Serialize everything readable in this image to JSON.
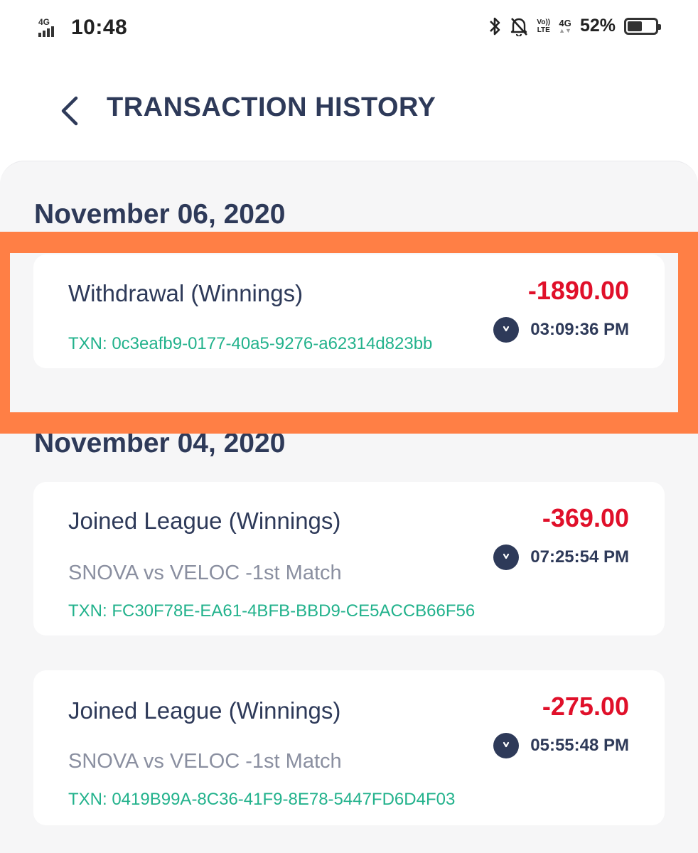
{
  "status_bar": {
    "network_label": "4G",
    "time": "10:48",
    "lte_top": "Vo))",
    "lte_bottom": "LTE",
    "network2": "4G",
    "battery_percent_text": "52%",
    "battery_level": 52
  },
  "header": {
    "title": "TRANSACTION HISTORY"
  },
  "groups": [
    {
      "date": "November 06, 2020",
      "transactions": [
        {
          "title": "Withdrawal (Winnings)",
          "subtitle": "",
          "txn": "TXN: 0c3eafb9-0177-40a5-9276-a62314d823bb",
          "amount": "-1890.00",
          "time": "03:09:36 PM"
        }
      ]
    },
    {
      "date": "November 04, 2020",
      "transactions": [
        {
          "title": "Joined League (Winnings)",
          "subtitle": "SNOVA vs VELOC -1st Match",
          "txn": "TXN: FC30F78E-EA61-4BFB-BBD9-CE5ACCB66F56",
          "amount": "-369.00",
          "time": "07:25:54 PM"
        },
        {
          "title": "Joined League (Winnings)",
          "subtitle": "SNOVA vs VELOC -1st Match",
          "txn": "TXN: 0419B99A-8C36-41F9-8E78-5447FD6D4F03",
          "amount": "-275.00",
          "time": "05:55:48 PM"
        }
      ]
    }
  ],
  "colors": {
    "text_primary": "#2e3a59",
    "amount_negative": "#e0102a",
    "txn_green": "#22b28c",
    "highlight": "#ff7f45",
    "panel_bg": "#f6f6f7"
  }
}
